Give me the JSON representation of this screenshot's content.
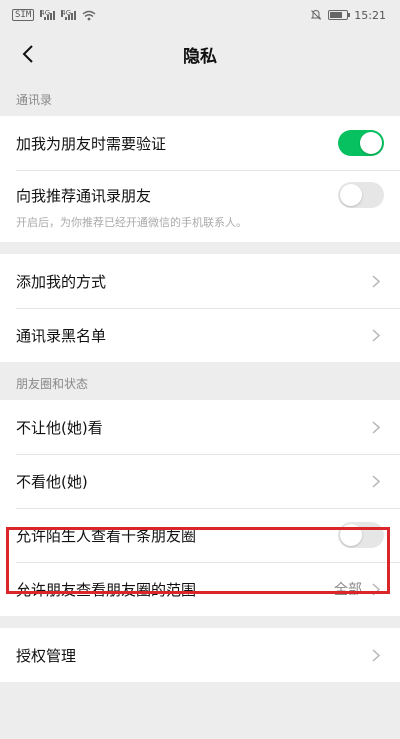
{
  "status_bar": {
    "sim_label": "SIM",
    "signal_1_tech": "4G",
    "signal_2_tech": "4G",
    "time": "15:21"
  },
  "nav": {
    "title": "隐私"
  },
  "sections": {
    "contacts": {
      "header": "通讯录",
      "verify_label": "加我为朋友时需要验证",
      "verify_on": true,
      "recommend_label": "向我推荐通讯录朋友",
      "recommend_on": false,
      "recommend_desc": "开启后，为你推荐已经开通微信的手机联系人。",
      "add_methods_label": "添加我的方式",
      "blacklist_label": "通讯录黑名单"
    },
    "moments": {
      "header": "朋友圈和状态",
      "hide_mine_label": "不让他(她)看",
      "hide_theirs_label": "不看他(她)",
      "strangers_label": "允许陌生人查看十条朋友圈",
      "strangers_on": false,
      "range_label": "允许朋友查看朋友圈的范围",
      "range_value": "全部"
    },
    "auth": {
      "label": "授权管理"
    }
  },
  "colors": {
    "toggle_on": "#07c160",
    "toggle_off": "#e6e6e6",
    "highlight": "#d9262b",
    "background": "#ededed"
  }
}
